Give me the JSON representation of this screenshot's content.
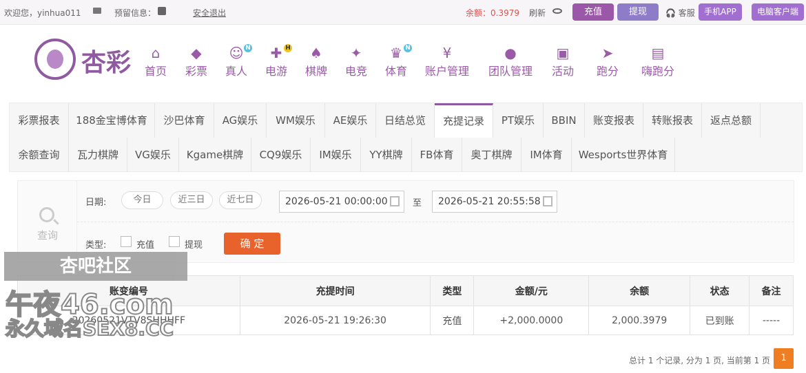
{
  "topbar": {
    "welcome": "欢迎您，yinhua011",
    "reserve": "预留信息：",
    "logout": "安全退出",
    "balance": "余额：0.3979",
    "refresh": "刷新",
    "charge": "充值",
    "withdraw": "提现",
    "service": "客服",
    "mobile_app": "手机APP",
    "pc_client": "电脑客户端"
  },
  "brand": "杏彩",
  "nav": [
    {
      "label": "首页",
      "icon": "home-icon"
    },
    {
      "label": "彩票",
      "icon": "lottery-icon"
    },
    {
      "label": "真人",
      "icon": "live-dealer-icon",
      "badge": "N"
    },
    {
      "label": "电游",
      "icon": "gamepad-icon",
      "badge": "H"
    },
    {
      "label": "棋牌",
      "icon": "cards-icon"
    },
    {
      "label": "电竞",
      "icon": "esports-icon"
    },
    {
      "label": "体育",
      "icon": "trophy-icon",
      "badge": "N"
    },
    {
      "label": "账户管理",
      "icon": "account-icon"
    },
    {
      "label": "团队管理",
      "icon": "team-icon"
    },
    {
      "label": "活动",
      "icon": "gift-icon"
    },
    {
      "label": "跑分",
      "icon": "score-icon"
    },
    {
      "label": "嗨跑分",
      "icon": "hi-score-icon"
    }
  ],
  "tabs_row1": [
    "彩票报表",
    "188金宝博体育",
    "沙巴体育",
    "AG娱乐",
    "WM娱乐",
    "AE娱乐",
    "日结总览",
    "充提记录",
    "PT娱乐",
    "BBIN",
    "账变报表",
    "转账报表",
    "返点总额"
  ],
  "tabs_row2": [
    "余额查询",
    "瓦力棋牌",
    "VG娱乐",
    "Kgame棋牌",
    "CQ9娱乐",
    "IM娱乐",
    "YY棋牌",
    "FB体育",
    "奥丁棋牌",
    "IM体育",
    "Wesports世界体育"
  ],
  "filter": {
    "side_label": "查询",
    "date_label": "日期:",
    "today": "今日",
    "three_days": "近三日",
    "seven_days": "近七日",
    "start": "2026-05-21 00:00:00",
    "to": "至",
    "end": "2026-05-21 20:55:58",
    "type_label": "类型:",
    "type_charge": "充值",
    "type_withdraw": "提现",
    "confirm": "确 定"
  },
  "table": {
    "headers": [
      "账变编号",
      "充提时间",
      "类型",
      "金额/元",
      "余额",
      "状态",
      "备注"
    ],
    "rows": [
      [
        "20260521VTV8SHHHFF",
        "2026-05-21 19:26:30",
        "充值",
        "+2,000.0000",
        "2,000.3979",
        "已到账",
        "-----"
      ]
    ]
  },
  "pager": {
    "summary": "总计 1 个记录, 分为 1 页, 当前第 1 页",
    "page": "1"
  },
  "watermark": {
    "line1": "杏吧社区",
    "line2": "午夜46.com",
    "line3": "永久域名SEX8.CC"
  }
}
